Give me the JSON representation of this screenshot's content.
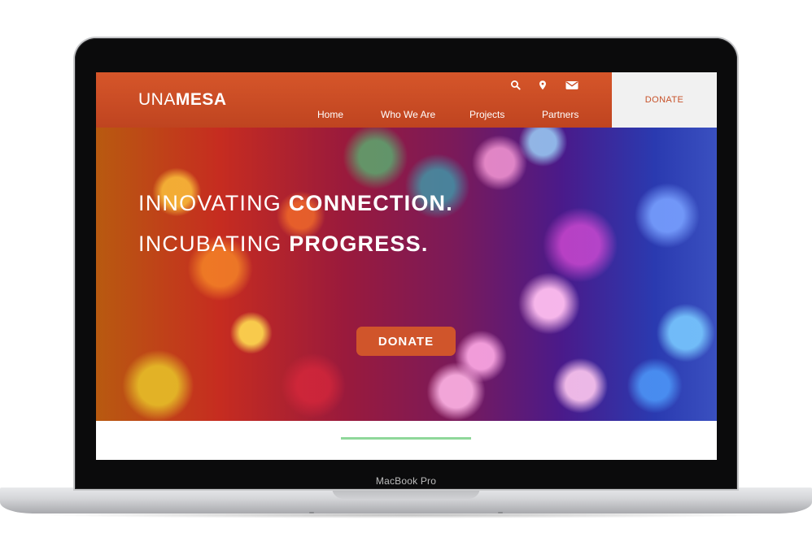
{
  "site": {
    "logo_thin": "UNA",
    "logo_bold": "MESA"
  },
  "header": {
    "icons": [
      "search-icon",
      "location-pin-icon",
      "mail-icon"
    ],
    "nav": [
      "Home",
      "Who We Are",
      "Projects",
      "Partners"
    ],
    "donate_tab_label": "DONATE",
    "accent_color": "#c8532b"
  },
  "hero": {
    "line1_light": "INNOVATING ",
    "line1_bold": "CONNECTION.",
    "line2_light": "INCUBATING ",
    "line2_bold": "PROGRESS.",
    "donate_button_label": "DONATE"
  },
  "device": {
    "label": "MacBook Pro"
  }
}
